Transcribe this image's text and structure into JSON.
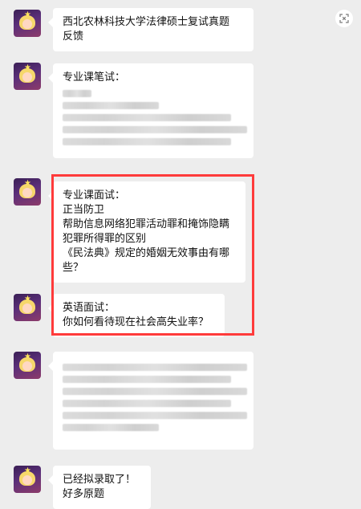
{
  "messages": [
    {
      "id": "m1",
      "lines": [
        "西北农林科技大学法律硕士复试真题",
        "反馈"
      ]
    },
    {
      "id": "m2",
      "lines": [
        "专业课笔试："
      ]
    },
    {
      "id": "m3",
      "lines": [
        "专业课面试：",
        "正当防卫",
        "帮助信息网络犯罪活动罪和掩饰隐瞒",
        "犯罪所得罪的区别",
        "《民法典》规定的婚姻无效事由有哪",
        "些？"
      ]
    },
    {
      "id": "m4",
      "lines": [
        "英语面试：",
        "你如何看待现在社会高失业率？"
      ]
    },
    {
      "id": "m5",
      "lines": []
    },
    {
      "id": "m6",
      "lines": [
        "已经拟录取了！",
        "好多原题"
      ]
    }
  ],
  "icons": {
    "avatar": "avatar-icon",
    "expand": "expand-icon"
  },
  "colors": {
    "background": "#ededed",
    "bubble": "#ffffff",
    "highlight": "#ff3b3b"
  }
}
